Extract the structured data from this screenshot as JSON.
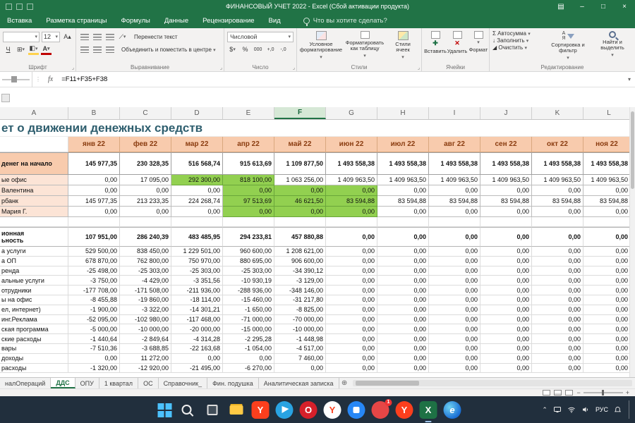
{
  "colors": {
    "accent_green": "#217346",
    "cell_green": "#92D050",
    "month_fill": "#F8CBAD",
    "label_fill": "#FCE4D6"
  },
  "titlebar": {
    "title": "ФИНАНСОВЫЙ УЧЕТ 2022 - Excel (Сбой активации продукта)"
  },
  "ribbon": {
    "tabs": [
      "Вставка",
      "Разметка страницы",
      "Формулы",
      "Данные",
      "Рецензирование",
      "Вид"
    ],
    "search_label": "Что вы хотите сделать?",
    "font": {
      "size": "12",
      "group": "Шрифт"
    },
    "alignment": {
      "wrap": "Перенести текст",
      "merge": "Объединить и поместить в центре",
      "group": "Выравнивание"
    },
    "number": {
      "format": "Числовой",
      "group": "Число"
    },
    "styles": {
      "conditional": "Условное форматирование",
      "as_table": "Форматировать как таблицу",
      "cell_styles": "Стили ячеек",
      "group": "Стили"
    },
    "cells": {
      "insert": "Вставить",
      "delete": "Удалить",
      "format": "Формат",
      "group": "Ячейки"
    },
    "editing": {
      "autosum": "Автосумма",
      "fill": "Заполнить",
      "clear": "Очистить",
      "sort": "Сортировка и фильтр",
      "find": "Найти и выделить",
      "group": "Редактирование"
    }
  },
  "formula_bar": {
    "fx": "fx",
    "formula": "=F11+F35+F38"
  },
  "grid": {
    "columns": [
      "A",
      "B",
      "C",
      "D",
      "E",
      "F",
      "G",
      "H",
      "I",
      "J",
      "K",
      "L"
    ],
    "selected_column": "F",
    "title": "ет о движении денежных средств",
    "months": [
      "янв 22",
      "фев 22",
      "мар 22",
      "апр 22",
      "май 22",
      "июн 22",
      "июл 22",
      "авг 22",
      "сен 22",
      "окт 22",
      "ноя 22"
    ],
    "rows": [
      {
        "label": "денег на начало",
        "style": "opening",
        "green": [],
        "cells": [
          "145 977,35",
          "230 328,35",
          "516 568,74",
          "915 613,69",
          "1 109 877,50",
          "1 493 558,38",
          "1 493 558,38",
          "1 493 558,38",
          "1 493 558,38",
          "1 493 558,38",
          "1 493 558,38"
        ]
      },
      {
        "label": "ые офис",
        "style": "account",
        "green": [
          2,
          3
        ],
        "cells": [
          "0,00",
          "17 095,00",
          "292 300,00",
          "818 100,00",
          "1 063 256,00",
          "1 409 963,50",
          "1 409 963,50",
          "1 409 963,50",
          "1 409 963,50",
          "1 409 963,50",
          "1 409 963,50"
        ]
      },
      {
        "label": " Валентина",
        "style": "account",
        "green": [
          3,
          4,
          5
        ],
        "cells": [
          "0,00",
          "0,00",
          "0,00",
          "0,00",
          "0,00",
          "0,00",
          "0,00",
          "0,00",
          "0,00",
          "0,00",
          "0,00"
        ]
      },
      {
        "label": "рбанк",
        "style": "account",
        "green": [
          3,
          4,
          5
        ],
        "cells": [
          "145 977,35",
          "213 233,35",
          "224 268,74",
          "97 513,69",
          "46 621,50",
          "83 594,88",
          "83 594,88",
          "83 594,88",
          "83 594,88",
          "83 594,88",
          "83 594,88"
        ]
      },
      {
        "label": " Мария Г.",
        "style": "account",
        "green": [
          3,
          4,
          5
        ],
        "cells": [
          "0,00",
          "0,00",
          "0,00",
          "0,00",
          "0,00",
          "0,00",
          "0,00",
          "0,00",
          "0,00",
          "0,00",
          "0,00"
        ]
      },
      {
        "label": "",
        "style": "empty",
        "green": [],
        "cells": [
          "",
          "",
          "",
          "",
          "",
          "",
          "",
          "",
          "",
          "",
          ""
        ]
      },
      {
        "label": "ионная\nьность",
        "style": "total",
        "green": [],
        "cells": [
          "107 951,00",
          "286 240,39",
          "483 485,95",
          "294 233,81",
          "457 880,88",
          "0,00",
          "0,00",
          "0,00",
          "0,00",
          "0,00",
          "0,00"
        ]
      },
      {
        "label": "а услуги",
        "style": "normal",
        "green": [],
        "cells": [
          "529 500,00",
          "838 450,00",
          "1 229 501,00",
          "960 600,00",
          "1 208 621,00",
          "0,00",
          "0,00",
          "0,00",
          "0,00",
          "0,00",
          "0,00"
        ]
      },
      {
        "label": "а ОП",
        "style": "normal",
        "green": [],
        "cells": [
          "678 870,00",
          "762 800,00",
          "750 970,00",
          "880 695,00",
          "906 600,00",
          "0,00",
          "0,00",
          "0,00",
          "0,00",
          "0,00",
          "0,00"
        ]
      },
      {
        "label": "ренда",
        "style": "normal",
        "green": [],
        "cells": [
          "-25 498,00",
          "-25 303,00",
          "-25 303,00",
          "-25 303,00",
          "-34 390,12",
          "0,00",
          "0,00",
          "0,00",
          "0,00",
          "0,00",
          "0,00"
        ]
      },
      {
        "label": "альные услуги",
        "style": "normal",
        "green": [],
        "cells": [
          "-3 750,00",
          "-4 429,00",
          "-3 351,56",
          "-10 930,19",
          "-3 129,00",
          "0,00",
          "0,00",
          "0,00",
          "0,00",
          "0,00",
          "0,00"
        ]
      },
      {
        "label": "отрудники",
        "style": "normal",
        "green": [],
        "cells": [
          "-177 708,00",
          "-171 508,00",
          "-211 936,00",
          "-288 936,00",
          "-348 146,00",
          "0,00",
          "0,00",
          "0,00",
          "0,00",
          "0,00",
          "0,00"
        ]
      },
      {
        "label": "ы на офис",
        "style": "normal",
        "green": [],
        "cells": [
          "-8 455,88",
          "-19 860,00",
          "-18 114,00",
          "-15 460,00",
          "-31 217,80",
          "0,00",
          "0,00",
          "0,00",
          "0,00",
          "0,00",
          "0,00"
        ]
      },
      {
        "label": "ел, интернет)",
        "style": "normal",
        "green": [],
        "cells": [
          "-1 900,00",
          "-3 322,00",
          "-14 301,21",
          "-1 650,00",
          "-8 825,00",
          "0,00",
          "0,00",
          "0,00",
          "0,00",
          "0,00",
          "0,00"
        ]
      },
      {
        "label": "инг.Реклама",
        "style": "normal",
        "green": [],
        "cells": [
          "-52 095,00",
          "-102 980,00",
          "-117 468,00",
          "-71 000,00",
          "-70 000,00",
          "0,00",
          "0,00",
          "0,00",
          "0,00",
          "0,00",
          "0,00"
        ]
      },
      {
        "label": "ская программа",
        "style": "normal",
        "green": [],
        "cells": [
          "-5 000,00",
          "-10 000,00",
          "-20 000,00",
          "-15 000,00",
          "-10 000,00",
          "0,00",
          "0,00",
          "0,00",
          "0,00",
          "0,00",
          "0,00"
        ]
      },
      {
        "label": "ские расходы",
        "style": "normal",
        "green": [],
        "cells": [
          "-1 440,64",
          "-2 849,64",
          "-4 314,28",
          "-2 295,28",
          "-1 448,98",
          "0,00",
          "0,00",
          "0,00",
          "0,00",
          "0,00",
          "0,00"
        ]
      },
      {
        "label": "вары",
        "style": "normal",
        "green": [],
        "cells": [
          "-7 510,36",
          "-3 688,85",
          "-22 163,68",
          "-1 054,00",
          "-4 517,00",
          "0,00",
          "0,00",
          "0,00",
          "0,00",
          "0,00",
          "0,00"
        ]
      },
      {
        "label": "доходы",
        "style": "normal",
        "green": [],
        "cells": [
          "0,00",
          "11 272,00",
          "0,00",
          "0,00",
          "7 460,00",
          "0,00",
          "0,00",
          "0,00",
          "0,00",
          "0,00",
          "0,00"
        ]
      },
      {
        "label": "расходы",
        "style": "normal",
        "green": [],
        "cells": [
          "-1 320,00",
          "-12 920,00",
          "-21 495,00",
          "-6 270,00",
          "0,00",
          "0,00",
          "0,00",
          "0,00",
          "0,00",
          "0,00",
          "0,00"
        ]
      }
    ]
  },
  "sheet_tabs": {
    "tabs": [
      "налОпераций",
      "ДДС",
      "ОПУ",
      "1 квартал",
      "ОС",
      "Справочник_",
      "Фин. подушка",
      "Аналитическая записка"
    ],
    "active": "ДДС"
  },
  "taskbar": {
    "icons": [
      {
        "name": "start-icon"
      },
      {
        "name": "search-icon"
      },
      {
        "name": "task-view-icon"
      },
      {
        "name": "folder-icon"
      },
      {
        "name": "yandex-browser-icon",
        "letter": "Y"
      },
      {
        "name": "telegram-icon"
      },
      {
        "name": "opera-icon",
        "letter": "O"
      },
      {
        "name": "yandex-icon",
        "letter": "Y"
      },
      {
        "name": "circle-app-icon"
      },
      {
        "name": "mail-app-icon",
        "badge": "1"
      },
      {
        "name": "yandex-start-icon",
        "letter": "Y"
      },
      {
        "name": "excel-icon",
        "letter": "X",
        "active": true
      },
      {
        "name": "edge-icon",
        "letter": "e"
      }
    ],
    "tray": {
      "language": "РУС"
    }
  }
}
